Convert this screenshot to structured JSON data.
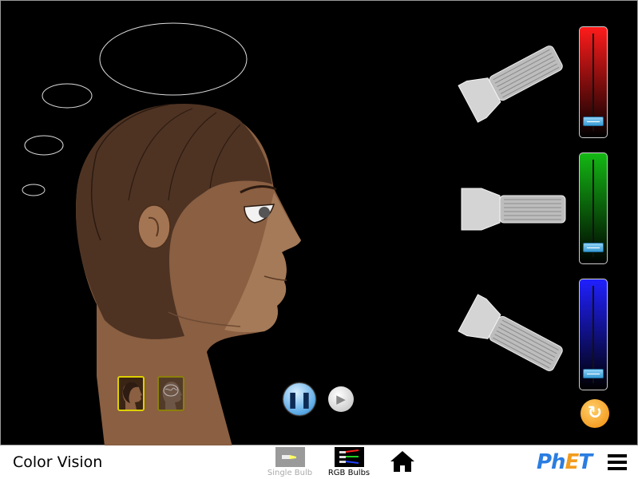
{
  "app": {
    "title": "Color Vision"
  },
  "navbar": {
    "screens": [
      {
        "label": "Single  Bulb",
        "active": false
      },
      {
        "label": "RGB  Bulbs",
        "active": true
      }
    ],
    "home_icon": "home-icon",
    "logo": "PhET",
    "menu_icon": "hamburger-menu-icon"
  },
  "controls": {
    "sliders": [
      {
        "color": "red",
        "value": 0
      },
      {
        "color": "green",
        "value": 0
      },
      {
        "color": "blue",
        "value": 0
      }
    ],
    "play_state": "playing",
    "reset_icon": "reset-all-icon",
    "view_options": [
      "head-profile-view",
      "head-brain-view"
    ]
  },
  "colors": {
    "background": "#000000",
    "red": "#ff1b1b",
    "green": "#14b814",
    "blue": "#2020ff",
    "accent": "#f18c0a"
  }
}
